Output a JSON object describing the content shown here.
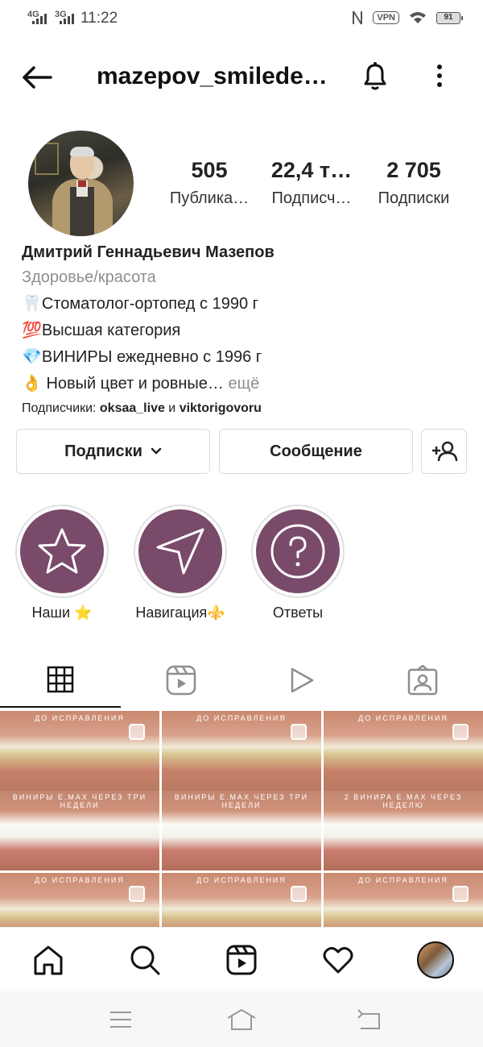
{
  "status_bar": {
    "network1": "4G",
    "network2": "3G",
    "time": "11:22",
    "vpn": "VPN",
    "battery": "91"
  },
  "header": {
    "username": "mazepov_smilede…",
    "back_icon": "arrow-left-icon",
    "bell_icon": "bell-icon",
    "more_icon": "more-vertical-icon"
  },
  "stats": [
    {
      "value": "505",
      "label": "Публика…"
    },
    {
      "value": "22,4 т…",
      "label": "Подписч…"
    },
    {
      "value": "2 705",
      "label": "Подписки"
    }
  ],
  "bio": {
    "name": "Дмитрий Геннадьевич Мазепов",
    "category": "Здоровье/красота",
    "lines": [
      "🦷Стоматолог-ортопед с 1990 г",
      "💯Высшая категория",
      "💎ВИНИРЫ ежедневно с 1996 г",
      "👌 Новый цвет и ровные…"
    ],
    "more": "ещё",
    "followers_prefix": "Подписчики: ",
    "follower1": "oksaa_live",
    "and": " и ",
    "follower2": "viktorigovoru"
  },
  "buttons": {
    "following": "Подписки",
    "message": "Сообщение"
  },
  "highlights": [
    {
      "label": "Наши ⭐",
      "icon": "star-icon"
    },
    {
      "label": "Навигация⚜️",
      "icon": "navigation-arrow-icon"
    },
    {
      "label": "Ответы",
      "icon": "question-icon"
    }
  ],
  "tabs": [
    {
      "icon": "grid-icon",
      "active": true
    },
    {
      "icon": "reels-icon",
      "active": false
    },
    {
      "icon": "play-icon",
      "active": false
    },
    {
      "icon": "tagged-icon",
      "active": false
    }
  ],
  "grid": {
    "captions_top": [
      "ДО ИСПРАВЛЕНИЯ",
      "ДО ИСПРАВЛЕНИЯ",
      "ДО ИСПРАВЛЕНИЯ",
      "ДО ИСПРАВЛЕНИЯ",
      "ДО ИСПРАВЛЕНИЯ",
      "ДО ИСПРАВЛЕНИЯ"
    ],
    "captions_bottom": [
      "ВИНИРЫ E.MAX ЧЕРЕЗ ТРИ НЕДЕЛИ",
      "ВИНИРЫ E.MAX ЧЕРЕЗ ТРИ НЕДЕЛИ",
      "2 ВИНИРА E.MAX ЧЕРЕЗ НЕДЕЛЮ"
    ]
  },
  "bottom_nav": [
    "home-icon",
    "search-icon",
    "reels-icon",
    "heart-icon",
    "profile-avatar"
  ],
  "system_nav": [
    "menu-icon",
    "home-outline-icon",
    "back-icon"
  ]
}
